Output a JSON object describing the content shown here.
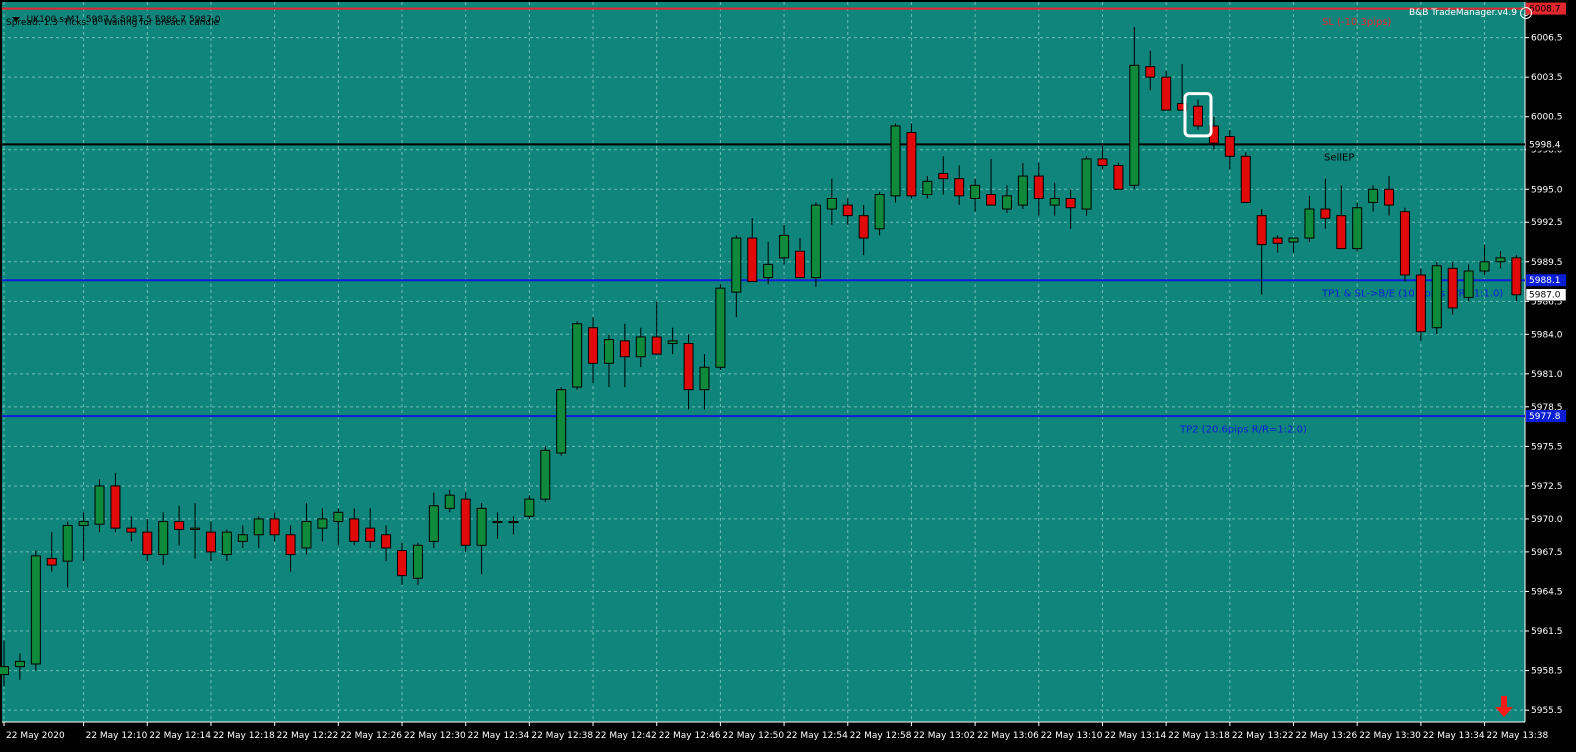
{
  "header": {
    "symbol_line": ".UK100.s,M1  5987.5 5987.5 5986.7 5987.0",
    "status_line": "Spread: 1.3  Ticks: 0  Waiting for breach candle",
    "ea_name": "B&B TradeManager.v4.9"
  },
  "colors": {
    "background": "#0f857b",
    "grid": "#6fbdb4",
    "bull": "#0f8a3a",
    "bear": "#e10a0a",
    "sl_line": "#e0282e",
    "entry_line": "#000000",
    "tp_line": "#0a1ed6",
    "axis_text": "#ffffff",
    "sell_arrow": "#ff1a1a"
  },
  "icons": {
    "menu": "triangle-down-icon",
    "ea_status": "smiley-icon",
    "trade_direction": "sell-arrow-icon"
  },
  "chart_data": {
    "type": "candlestick",
    "symbol": ".UK100.s",
    "timeframe": "M1",
    "ylim": [
      5954.6,
      6009.2
    ],
    "y_ticks": [
      5955.5,
      5958.5,
      5961.5,
      5964.5,
      5967.5,
      5970.0,
      5972.5,
      5975.5,
      5978.5,
      5981.0,
      5984.0,
      5986.5,
      5989.5,
      5992.5,
      5995.0,
      5998.0,
      6000.5,
      6003.5,
      6006.5
    ],
    "y_tick_labels": [
      "5955.5",
      "5958.5",
      "5961.5",
      "5964.5",
      "5967.5",
      "5970.0",
      "5972.5",
      "5975.5",
      "5978.5",
      "5981.0",
      "5984.0",
      "5986.5",
      "5989.5",
      "5992.5",
      "5995.0",
      "5998.0",
      "6000.5",
      "6003.5",
      "6006.5"
    ],
    "x_labels": [
      {
        "index": 0,
        "text": "22 May 2020"
      },
      {
        "index": 5,
        "text": "22 May 12:10"
      },
      {
        "index": 9,
        "text": "22 May 12:14"
      },
      {
        "index": 13,
        "text": "22 May 12:18"
      },
      {
        "index": 17,
        "text": "22 May 12:22"
      },
      {
        "index": 21,
        "text": "22 May 12:26"
      },
      {
        "index": 25,
        "text": "22 May 12:30"
      },
      {
        "index": 29,
        "text": "22 May 12:34"
      },
      {
        "index": 33,
        "text": "22 May 12:38"
      },
      {
        "index": 37,
        "text": "22 May 12:42"
      },
      {
        "index": 41,
        "text": "22 May 12:46"
      },
      {
        "index": 45,
        "text": "22 May 12:50"
      },
      {
        "index": 49,
        "text": "22 May 12:54"
      },
      {
        "index": 53,
        "text": "22 May 12:58"
      },
      {
        "index": 57,
        "text": "22 May 13:02"
      },
      {
        "index": 61,
        "text": "22 May 13:06"
      },
      {
        "index": 65,
        "text": "22 May 13:10"
      },
      {
        "index": 69,
        "text": "22 May 13:14"
      },
      {
        "index": 73,
        "text": "22 May 13:18"
      },
      {
        "index": 77,
        "text": "22 May 13:22"
      },
      {
        "index": 81,
        "text": "22 May 13:26"
      },
      {
        "index": 85,
        "text": "22 May 13:30"
      },
      {
        "index": 89,
        "text": "22 May 13:34"
      },
      {
        "index": 93,
        "text": "22 May 13:38"
      }
    ],
    "candles": [
      {
        "o": 5958.2,
        "h": 5960.8,
        "l": 5957.3,
        "c": 5958.8
      },
      {
        "o": 5958.8,
        "h": 5959.8,
        "l": 5957.8,
        "c": 5959.2
      },
      {
        "o": 5959.0,
        "h": 5967.6,
        "l": 5958.5,
        "c": 5967.2
      },
      {
        "o": 5967.0,
        "h": 5969.0,
        "l": 5966.0,
        "c": 5966.5
      },
      {
        "o": 5966.8,
        "h": 5969.8,
        "l": 5964.8,
        "c": 5969.5
      },
      {
        "o": 5969.5,
        "h": 5970.5,
        "l": 5966.8,
        "c": 5969.8
      },
      {
        "o": 5969.6,
        "h": 5973.0,
        "l": 5969.0,
        "c": 5972.5
      },
      {
        "o": 5972.5,
        "h": 5973.5,
        "l": 5969.0,
        "c": 5969.3
      },
      {
        "o": 5969.3,
        "h": 5970.2,
        "l": 5968.3,
        "c": 5969.0
      },
      {
        "o": 5969.0,
        "h": 5970.0,
        "l": 5966.8,
        "c": 5967.3
      },
      {
        "o": 5967.3,
        "h": 5970.5,
        "l": 5966.5,
        "c": 5969.8
      },
      {
        "o": 5969.8,
        "h": 5971.0,
        "l": 5968.0,
        "c": 5969.2
      },
      {
        "o": 5969.2,
        "h": 5971.2,
        "l": 5967.0,
        "c": 5969.3
      },
      {
        "o": 5969.0,
        "h": 5969.8,
        "l": 5966.8,
        "c": 5967.5
      },
      {
        "o": 5967.3,
        "h": 5969.2,
        "l": 5966.8,
        "c": 5969.0
      },
      {
        "o": 5968.3,
        "h": 5969.5,
        "l": 5967.8,
        "c": 5968.8
      },
      {
        "o": 5968.8,
        "h": 5970.2,
        "l": 5967.8,
        "c": 5970.0
      },
      {
        "o": 5970.0,
        "h": 5970.5,
        "l": 5968.3,
        "c": 5968.8
      },
      {
        "o": 5968.8,
        "h": 5969.5,
        "l": 5966.0,
        "c": 5967.3
      },
      {
        "o": 5967.8,
        "h": 5971.2,
        "l": 5967.3,
        "c": 5969.8
      },
      {
        "o": 5969.3,
        "h": 5970.8,
        "l": 5968.3,
        "c": 5970.0
      },
      {
        "o": 5969.8,
        "h": 5970.8,
        "l": 5968.0,
        "c": 5970.5
      },
      {
        "o": 5970.0,
        "h": 5970.8,
        "l": 5968.0,
        "c": 5968.3
      },
      {
        "o": 5969.3,
        "h": 5970.8,
        "l": 5967.8,
        "c": 5968.3
      },
      {
        "o": 5968.8,
        "h": 5969.5,
        "l": 5966.8,
        "c": 5967.8
      },
      {
        "o": 5967.6,
        "h": 5968.2,
        "l": 5965.0,
        "c": 5965.7
      },
      {
        "o": 5965.5,
        "h": 5968.2,
        "l": 5965.0,
        "c": 5968.0
      },
      {
        "o": 5968.3,
        "h": 5972.0,
        "l": 5967.8,
        "c": 5971.0
      },
      {
        "o": 5970.8,
        "h": 5972.2,
        "l": 5970.5,
        "c": 5971.8
      },
      {
        "o": 5971.5,
        "h": 5972.0,
        "l": 5967.5,
        "c": 5968.0
      },
      {
        "o": 5968.0,
        "h": 5971.2,
        "l": 5965.8,
        "c": 5970.8
      },
      {
        "o": 5969.8,
        "h": 5970.5,
        "l": 5968.5,
        "c": 5969.8
      },
      {
        "o": 5969.8,
        "h": 5970.2,
        "l": 5968.8,
        "c": 5969.8
      },
      {
        "o": 5970.2,
        "h": 5971.8,
        "l": 5970.0,
        "c": 5971.5
      },
      {
        "o": 5971.5,
        "h": 5975.5,
        "l": 5971.3,
        "c": 5975.2
      },
      {
        "o": 5975.0,
        "h": 5980.0,
        "l": 5974.8,
        "c": 5979.8
      },
      {
        "o": 5980.0,
        "h": 5985.0,
        "l": 5979.8,
        "c": 5984.8
      },
      {
        "o": 5984.5,
        "h": 5985.3,
        "l": 5980.3,
        "c": 5981.8
      },
      {
        "o": 5981.8,
        "h": 5984.0,
        "l": 5980.0,
        "c": 5983.6
      },
      {
        "o": 5983.5,
        "h": 5984.8,
        "l": 5980.0,
        "c": 5982.3
      },
      {
        "o": 5982.3,
        "h": 5984.5,
        "l": 5981.5,
        "c": 5983.8
      },
      {
        "o": 5983.8,
        "h": 5986.5,
        "l": 5982.5,
        "c": 5982.5
      },
      {
        "o": 5983.3,
        "h": 5984.5,
        "l": 5982.5,
        "c": 5983.5
      },
      {
        "o": 5983.3,
        "h": 5984.0,
        "l": 5978.3,
        "c": 5979.8
      },
      {
        "o": 5979.8,
        "h": 5982.5,
        "l": 5978.3,
        "c": 5981.5
      },
      {
        "o": 5981.5,
        "h": 5987.8,
        "l": 5981.3,
        "c": 5987.5
      },
      {
        "o": 5987.2,
        "h": 5991.5,
        "l": 5985.3,
        "c": 5991.3
      },
      {
        "o": 5991.3,
        "h": 5992.8,
        "l": 5988.0,
        "c": 5988.0
      },
      {
        "o": 5988.3,
        "h": 5991.0,
        "l": 5987.8,
        "c": 5989.3
      },
      {
        "o": 5989.8,
        "h": 5992.3,
        "l": 5989.3,
        "c": 5991.5
      },
      {
        "o": 5990.3,
        "h": 5991.3,
        "l": 5988.3,
        "c": 5988.3
      },
      {
        "o": 5988.3,
        "h": 5994.0,
        "l": 5987.6,
        "c": 5993.8
      },
      {
        "o": 5993.5,
        "h": 5995.8,
        "l": 5992.3,
        "c": 5994.3
      },
      {
        "o": 5993.8,
        "h": 5994.3,
        "l": 5992.3,
        "c": 5993.0
      },
      {
        "o": 5993.0,
        "h": 5993.8,
        "l": 5990.0,
        "c": 5991.3
      },
      {
        "o": 5992.0,
        "h": 5994.8,
        "l": 5991.5,
        "c": 5994.6
      },
      {
        "o": 5994.5,
        "h": 6000.0,
        "l": 5994.0,
        "c": 5999.8
      },
      {
        "o": 5999.3,
        "h": 6000.0,
        "l": 5994.3,
        "c": 5994.5
      },
      {
        "o": 5994.6,
        "h": 5996.0,
        "l": 5994.3,
        "c": 5995.6
      },
      {
        "o": 5996.2,
        "h": 5997.5,
        "l": 5994.6,
        "c": 5995.8
      },
      {
        "o": 5995.8,
        "h": 5996.8,
        "l": 5993.8,
        "c": 5994.5
      },
      {
        "o": 5994.3,
        "h": 5995.8,
        "l": 5993.3,
        "c": 5995.3
      },
      {
        "o": 5994.6,
        "h": 5997.3,
        "l": 5993.8,
        "c": 5993.8
      },
      {
        "o": 5993.5,
        "h": 5995.3,
        "l": 5993.2,
        "c": 5994.5
      },
      {
        "o": 5993.8,
        "h": 5997.0,
        "l": 5993.5,
        "c": 5996.0
      },
      {
        "o": 5996.0,
        "h": 5997.0,
        "l": 5993.0,
        "c": 5994.3
      },
      {
        "o": 5993.8,
        "h": 5995.5,
        "l": 5993.0,
        "c": 5994.3
      },
      {
        "o": 5994.3,
        "h": 5995.0,
        "l": 5992.0,
        "c": 5993.6
      },
      {
        "o": 5993.5,
        "h": 5997.5,
        "l": 5993.0,
        "c": 5997.3
      },
      {
        "o": 5997.3,
        "h": 5998.3,
        "l": 5996.5,
        "c": 5996.8
      },
      {
        "o": 5996.8,
        "h": 5997.0,
        "l": 5995.0,
        "c": 5995.0
      },
      {
        "o": 5995.3,
        "h": 6007.3,
        "l": 5995.0,
        "c": 6004.4
      },
      {
        "o": 6004.3,
        "h": 6005.5,
        "l": 6002.5,
        "c": 6003.5
      },
      {
        "o": 6003.5,
        "h": 6004.0,
        "l": 6001.0,
        "c": 6001.0
      },
      {
        "o": 6001.5,
        "h": 6004.5,
        "l": 6001.0,
        "c": 6001.0
      },
      {
        "o": 6001.3,
        "h": 6001.8,
        "l": 5999.5,
        "c": 5999.8
      },
      {
        "o": 5999.8,
        "h": 6000.5,
        "l": 5998.0,
        "c": 5998.5
      },
      {
        "o": 5999.0,
        "h": 5999.5,
        "l": 5996.5,
        "c": 5997.5
      },
      {
        "o": 5997.5,
        "h": 5997.8,
        "l": 5994.0,
        "c": 5994.0
      },
      {
        "o": 5993.0,
        "h": 5993.5,
        "l": 5987.0,
        "c": 5990.8
      },
      {
        "o": 5991.3,
        "h": 5991.5,
        "l": 5990.2,
        "c": 5990.9
      },
      {
        "o": 5991.0,
        "h": 5991.3,
        "l": 5990.2,
        "c": 5991.3
      },
      {
        "o": 5991.3,
        "h": 5994.5,
        "l": 5991.0,
        "c": 5993.5
      },
      {
        "o": 5993.5,
        "h": 5995.8,
        "l": 5992.0,
        "c": 5992.8
      },
      {
        "o": 5993.0,
        "h": 5995.3,
        "l": 5990.5,
        "c": 5990.5
      },
      {
        "o": 5990.5,
        "h": 5994.0,
        "l": 5990.3,
        "c": 5993.6
      },
      {
        "o": 5994.0,
        "h": 5995.3,
        "l": 5993.3,
        "c": 5995.0
      },
      {
        "o": 5995.0,
        "h": 5996.0,
        "l": 5993.0,
        "c": 5993.8
      },
      {
        "o": 5993.3,
        "h": 5993.6,
        "l": 5988.0,
        "c": 5988.5
      },
      {
        "o": 5988.5,
        "h": 5989.0,
        "l": 5983.5,
        "c": 5984.2
      },
      {
        "o": 5984.5,
        "h": 5989.5,
        "l": 5984.0,
        "c": 5989.2
      },
      {
        "o": 5989.0,
        "h": 5989.5,
        "l": 5985.5,
        "c": 5986.0
      },
      {
        "o": 5986.8,
        "h": 5989.3,
        "l": 5986.5,
        "c": 5988.8
      },
      {
        "o": 5988.8,
        "h": 5990.8,
        "l": 5988.5,
        "c": 5989.5
      },
      {
        "o": 5989.5,
        "h": 5990.3,
        "l": 5989.0,
        "c": 5989.8
      },
      {
        "o": 5989.8,
        "h": 5990.0,
        "l": 5986.5,
        "c": 5987.0
      },
      {
        "o": 5987.5,
        "h": 5987.5,
        "l": 5986.7,
        "c": 5987.0
      }
    ],
    "highlight_index": 75,
    "price_lines": [
      {
        "name": "sl",
        "price": 6008.7,
        "color": "#e0282e",
        "label": "SL (-10.3pips)",
        "label_price": 6007.7,
        "label_x": 1322,
        "tag": "6008.7",
        "tag_bg": "#e0282e",
        "tag_fg": "#000000"
      },
      {
        "name": "sell-entry",
        "price": 5998.4,
        "color": "#000000",
        "label": "SellEP",
        "label_price": 5997.4,
        "label_x": 1324,
        "tag": "5998.4",
        "tag_bg": "#000000",
        "tag_fg": "#ffffff"
      },
      {
        "name": "tp1",
        "price": 5988.1,
        "color": "#0a1ed6",
        "label": "TP1 & SL->B/E (10.3pips R/R=1:1.0)",
        "label_price": 5987.1,
        "label_x": 1322,
        "tag": "5988.1",
        "tag_bg": "#0a1ed6",
        "tag_fg": "#ffffff"
      },
      {
        "name": "tp2",
        "price": 5977.8,
        "color": "#0a1ed6",
        "label": "TP2 (20.6pips R/R=1:2.0)",
        "label_price": 5976.8,
        "label_x": 1180,
        "tag": "5977.8",
        "tag_bg": "#0a1ed6",
        "tag_fg": "#ffffff"
      }
    ],
    "bid_price": {
      "price": 5987.0,
      "tag": "5987.0",
      "tag_bg": "#ffffff",
      "tag_fg": "#000000"
    }
  }
}
